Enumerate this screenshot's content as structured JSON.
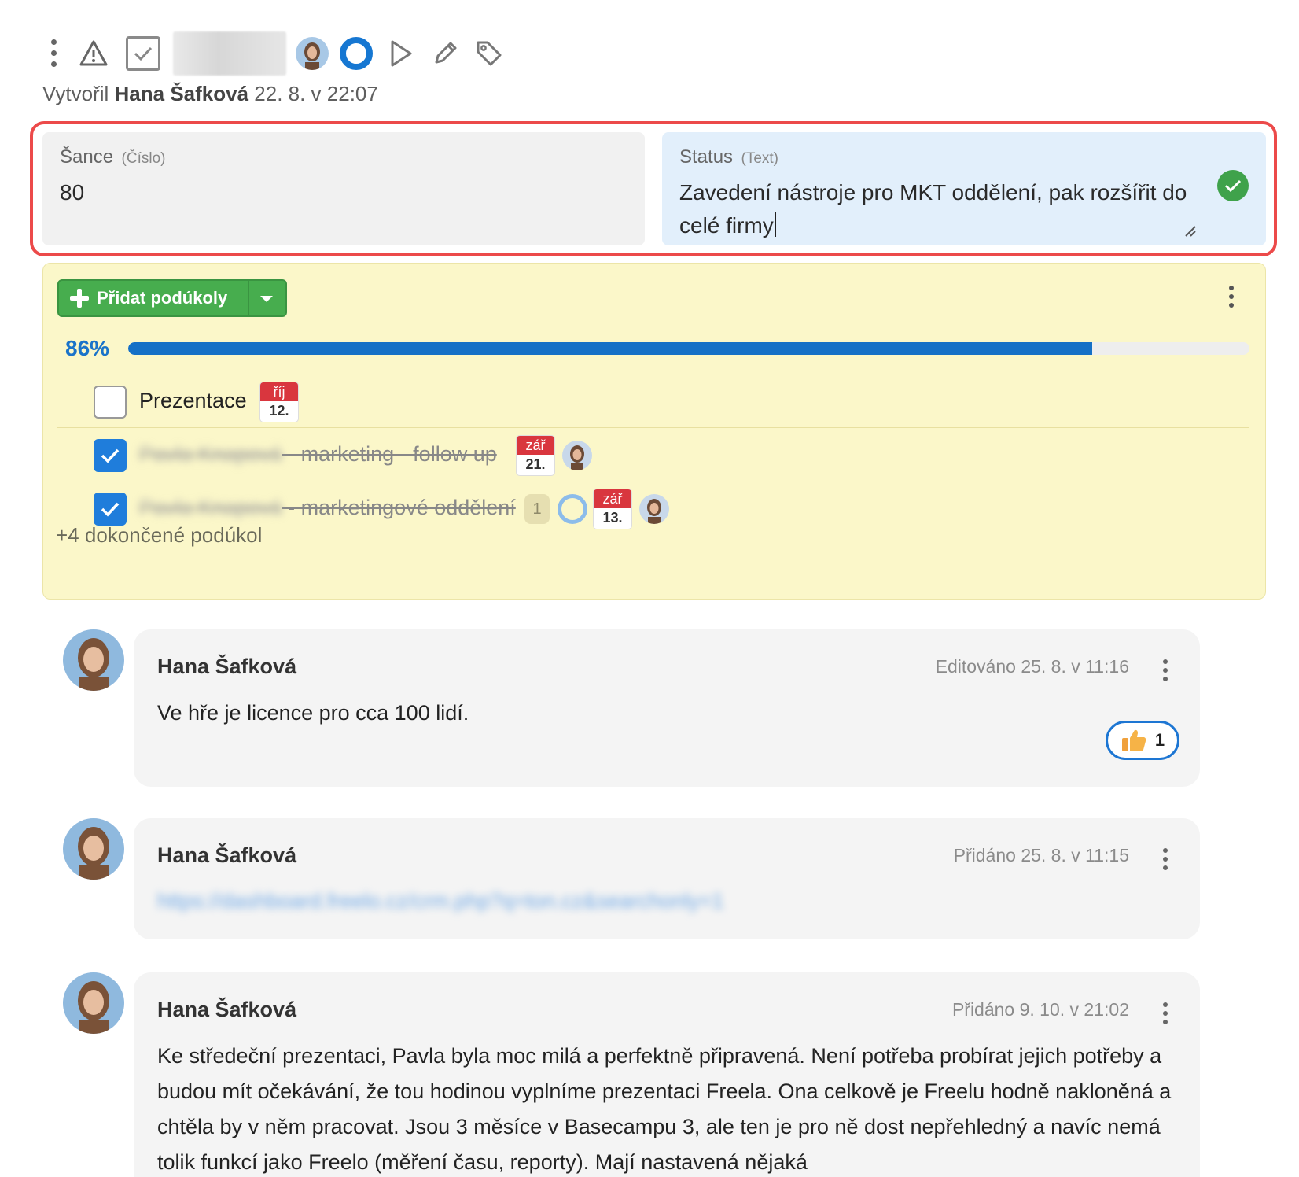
{
  "meta": {
    "created_prefix": "Vytvořil",
    "created_author": "Hana Šafková",
    "created_time": "22. 8. v 22:07"
  },
  "fields": {
    "sance": {
      "label": "Šance",
      "type": "(Číslo)",
      "value": "80"
    },
    "status": {
      "label": "Status",
      "type": "(Text)",
      "value": "Zavedení nástroje pro MKT oddělení, pak rozšířit do celé firmy"
    }
  },
  "subtasks": {
    "add_label": "Přidat podúkoly",
    "progress_text": "86%",
    "progress_fraction": 0.86,
    "items": [
      {
        "prefix": "",
        "text": "Prezentace",
        "done": false,
        "month": "říj",
        "day": "12."
      },
      {
        "prefix": "Pavla Knapová",
        "text": " - marketing - follow up",
        "done": true,
        "month": "zář",
        "day": "21."
      },
      {
        "prefix": "Pavla Knapová",
        "text": " - marketingové oddělení",
        "done": true,
        "count": "1",
        "month": "zář",
        "day": "13."
      }
    ],
    "more_done": "+4 dokončené podúkol"
  },
  "comments": [
    {
      "author": "Hana Šafková",
      "time": "Editováno 25. 8. v 11:16",
      "body": "Ve hře je licence pro cca 100 lidí.",
      "reaction_count": "1"
    },
    {
      "author": "Hana Šafková",
      "time": "Přidáno 25. 8. v 11:15",
      "link": "https://dashboard.freelo.cz/crm.php?q=ton.cz&searchonly=1"
    },
    {
      "author": "Hana Šafková",
      "time": "Přidáno 9. 10. v 21:02",
      "body": "Ke středeční prezentaci, Pavla byla moc milá a perfektně připravená. Není potřeba probírat jejich potřeby a budou mít očekávání, že tou hodinou vyplníme prezentaci Freela. Ona celkově je Freelu hodně nakloněná a chtěla by v něm pracovat. Jsou 3 měsíce v Basecampu 3, ale ten je pro ně dost nepřehledný a navíc nemá tolik funkcí jako Freelo (měření času, reporty). Mají nastavená nějaká"
    }
  ],
  "colors": {
    "accent": "#1570c6",
    "success": "#47ad4e",
    "highlight": "#ec4a4a",
    "subtask_bg": "#fbf7c9"
  }
}
